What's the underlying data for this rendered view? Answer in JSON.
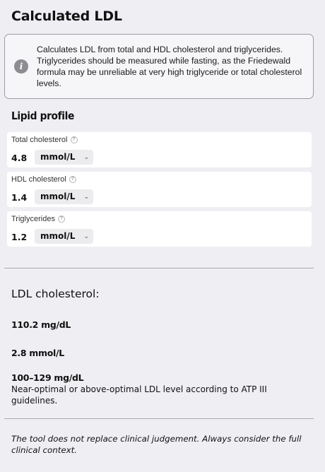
{
  "page": {
    "title": "Calculated LDL"
  },
  "info": {
    "icon": "info-icon",
    "icon_glyph": "i",
    "text": "Calculates LDL from total and HDL cholesterol and triglycerides. Triglycerides should be measured while fasting, as the Friedewald formula may be unreliable at very high triglyceride or total cholesterol levels."
  },
  "lipid_profile": {
    "title": "Lipid profile",
    "fields": [
      {
        "label": "Total cholesterol",
        "value": "4.8",
        "unit": "mmol/L"
      },
      {
        "label": "HDL cholesterol",
        "value": "1.4",
        "unit": "mmol/L"
      },
      {
        "label": "Triglycerides",
        "value": "1.2",
        "unit": "mmol/L"
      }
    ],
    "help_glyph": "?",
    "chevron_glyph": "⌄"
  },
  "result": {
    "heading": "LDL cholesterol:",
    "mg_dl": "110.2 mg/dL",
    "mmol_l": "2.8 mmol/L",
    "range": "100–129 mg/dL",
    "description": "Near-optimal or above-optimal LDL level according to ATP III guidelines."
  },
  "disclaimer": "The tool does not replace clinical judgement. Always consider the full clinical context."
}
